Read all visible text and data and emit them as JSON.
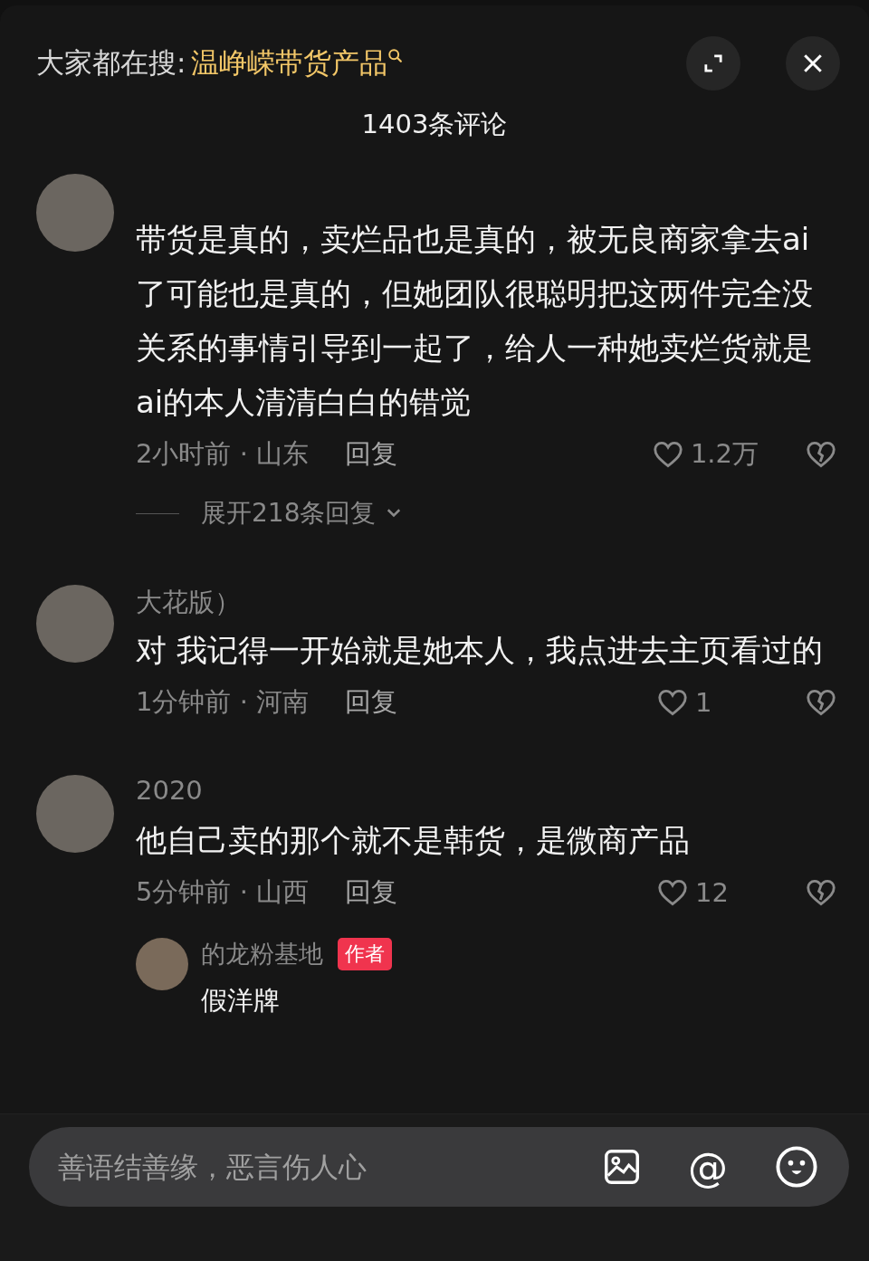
{
  "search_bar": {
    "label": "大家都在搜:",
    "query": "温峥嵘带货产品"
  },
  "comment_count": "1403条评论",
  "comments": [
    {
      "text": "带货是真的，卖烂品也是真的，被无良商家拿去ai了可能也是真的，但她团队很聪明把这两件完全没关系的事情引导到一起了，给人一种她卖烂货就是ai的本人清清白白的错觉",
      "time_location": "2小时前 · 山东",
      "reply_label": "回复",
      "likes": "1.2万",
      "expand_replies": "展开218条回复"
    },
    {
      "username": "大花版）",
      "text": "对 我记得一开始就是她本人，我点进去主页看过的",
      "time_location": "1分钟前 · 河南",
      "reply_label": "回复",
      "likes": "1"
    },
    {
      "username": "2020",
      "text": "他自己卖的那个就不是韩货，是微商产品",
      "time_location": "5分钟前 · 山西",
      "reply_label": "回复",
      "likes": "12",
      "reply": {
        "username": "的龙粉基地",
        "badge": "作者",
        "text": "假洋牌"
      }
    }
  ],
  "input": {
    "placeholder": "善语结善缘，恶言伤人心",
    "mention_button": "@"
  }
}
